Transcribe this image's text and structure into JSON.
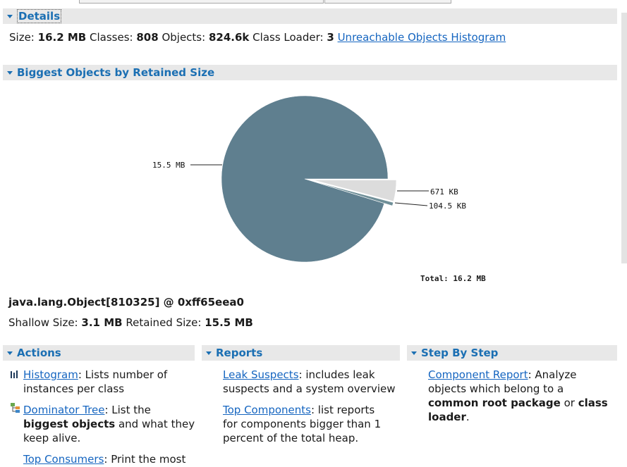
{
  "details": {
    "title": "Details",
    "size_label": "Size:",
    "size_value": "16.2 MB",
    "classes_label": "Classes:",
    "classes_value": "808",
    "objects_label": "Objects:",
    "objects_value": "824.6k",
    "loader_label": "Class Loader:",
    "loader_value": "3",
    "unreachable_link": "Unreachable Objects Histogram"
  },
  "biggest": {
    "title": "Biggest Objects by Retained Size",
    "chart": {
      "type": "pie",
      "slices": [
        {
          "label": "15.5 MB",
          "value": 15.5,
          "color": "#5f7f8f"
        },
        {
          "label": "671 KB",
          "value": 0.671,
          "color": "#dcdcdc"
        },
        {
          "label": "104.5 KB",
          "value": 0.1045,
          "color": "#6f8f98"
        }
      ],
      "total": "Total: 16.2 MB"
    },
    "object_name": "java.lang.Object[810325] @ 0xff65eea0",
    "shallow_label": "Shallow Size:",
    "shallow_value": "3.1 MB",
    "retained_label": "Retained Size:",
    "retained_value": "15.5 MB"
  },
  "actions": {
    "title": "Actions",
    "histogram_link": "Histogram",
    "histogram_desc_1": ": Lists number of",
    "histogram_desc_2": "instances per class",
    "dominator_link": "Dominator Tree",
    "dominator_desc_1": ": List the",
    "dominator_bold": "biggest objects",
    "dominator_desc_2": " and what they",
    "dominator_desc_3": "keep alive.",
    "consumers_link": "Top Consumers",
    "consumers_desc": ": Print the most"
  },
  "reports": {
    "title": "Reports",
    "leak_link": "Leak Suspects",
    "leak_desc_1": ": includes leak",
    "leak_desc_2": "suspects and a system overview",
    "top_link": "Top Components",
    "top_desc_1": ": list reports",
    "top_desc_2": "for components bigger than 1",
    "top_desc_3": "percent of the total heap."
  },
  "steps": {
    "title": "Step By Step",
    "component_link": "Component Report",
    "component_desc_1": ": Analyze",
    "component_desc_2": "objects which belong to a",
    "component_bold_1": "common root package",
    "component_or": " or ",
    "component_bold_2": "class",
    "component_bold_3": "loader",
    "component_end": "."
  }
}
